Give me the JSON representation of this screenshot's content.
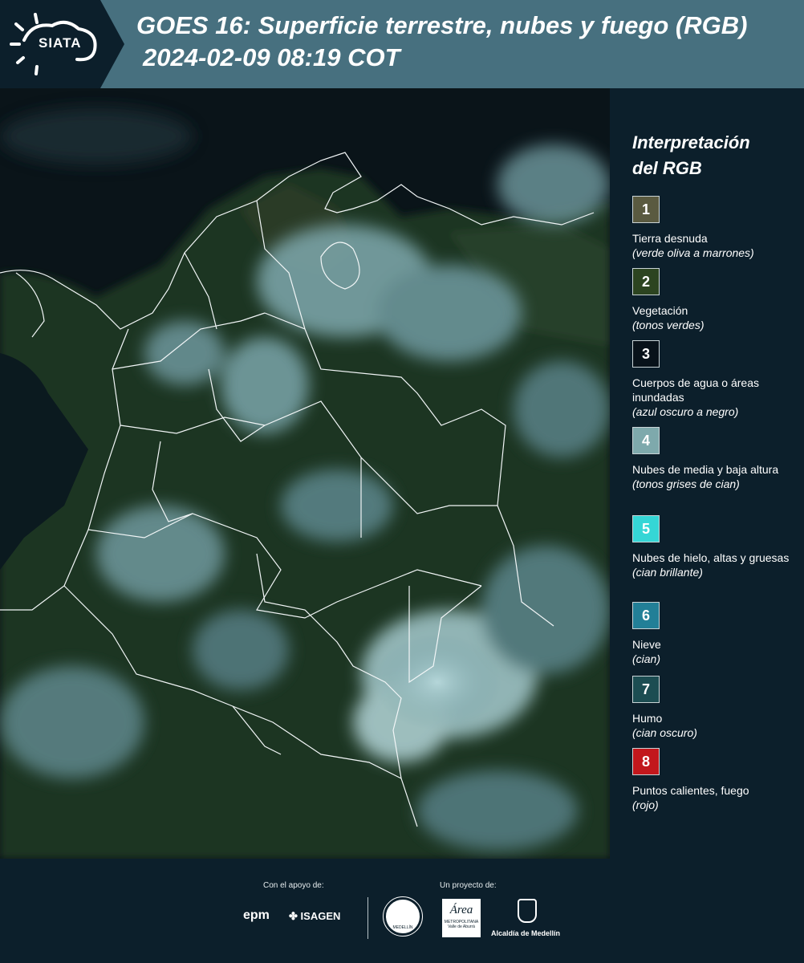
{
  "header": {
    "logo_text": "SIATA",
    "title_line1": "GOES 16: Superficie terrestre, nubes y fuego (RGB)",
    "title_line2": "2024-02-09 08:19 COT"
  },
  "legend": {
    "title_line1": "Interpretación",
    "title_line2": "del RGB",
    "items": [
      {
        "num": "1",
        "color": "#5a5a40",
        "label": "Tierra desnuda",
        "sub": "(verde oliva a marrones)"
      },
      {
        "num": "2",
        "color": "#2c4420",
        "label": "Vegetación",
        "sub": "(tonos verdes)"
      },
      {
        "num": "3",
        "color": "#08121a",
        "label": "Cuerpos de agua o áreas inundadas",
        "sub": "(azul oscuro a negro)"
      },
      {
        "num": "4",
        "color": "#7ea9ac",
        "label": "Nubes de media y baja altura",
        "sub": "(tonos grises de cian)"
      },
      {
        "num": "5",
        "color": "#35d6d6",
        "label": "Nubes de hielo, altas y gruesas",
        "sub": "(cian brillante)"
      },
      {
        "num": "6",
        "color": "#227f97",
        "label": "Nieve",
        "sub": "(cian)"
      },
      {
        "num": "7",
        "color": "#1c4d52",
        "label": "Humo",
        "sub": "(cian oscuro)"
      },
      {
        "num": "8",
        "color": "#c2171c",
        "label": "Puntos calientes, fuego",
        "sub": "(rojo)"
      }
    ]
  },
  "footer": {
    "support_label": "Con el apoyo de:",
    "project_label": "Un proyecto de:",
    "epm": "epm",
    "isagen": "ISAGEN",
    "metro_line1": "Área",
    "metro_line2": "METROPOLITANA",
    "metro_line3": "Valle de Aburrá",
    "alcaldia": "Alcaldía de Medellín",
    "seal_text": "MEDELLÍN"
  },
  "colors": {
    "header_bg": "#47707f",
    "panel_bg": "#0c1f2b",
    "vegetation": "#1e3a1c",
    "cloud": "#8fb7bc"
  }
}
